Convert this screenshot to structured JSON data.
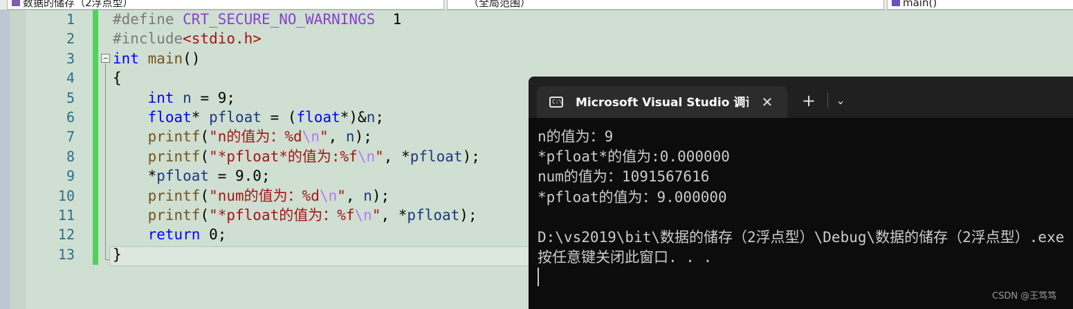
{
  "navbar": {
    "file_dropdown": "数据的储存（2浮点型）",
    "scope_dropdown": "（全局范围）",
    "member_dropdown": "main()"
  },
  "editor": {
    "line_numbers": [
      "1",
      "2",
      "3",
      "4",
      "5",
      "6",
      "7",
      "8",
      "9",
      "10",
      "11",
      "12",
      "13"
    ],
    "fold_toggle": "−"
  },
  "console": {
    "tab_title": "Microsoft Visual Studio 调试控制台",
    "tab_icon_text": "C:\\",
    "close_glyph": "✕",
    "new_tab_glyph": "+",
    "dropdown_glyph": "⌄",
    "output": [
      "n的值为：9",
      "*pfloat*的值为:0.000000",
      "num的值为：1091567616",
      "*pfloat的值为：9.000000",
      "",
      "D:\\vs2019\\bit\\数据的储存（2浮点型）\\Debug\\数据的储存（2浮点型）.exe",
      "按任意键关闭此窗口. . ."
    ]
  },
  "watermark": "CSDN @王笃笃"
}
